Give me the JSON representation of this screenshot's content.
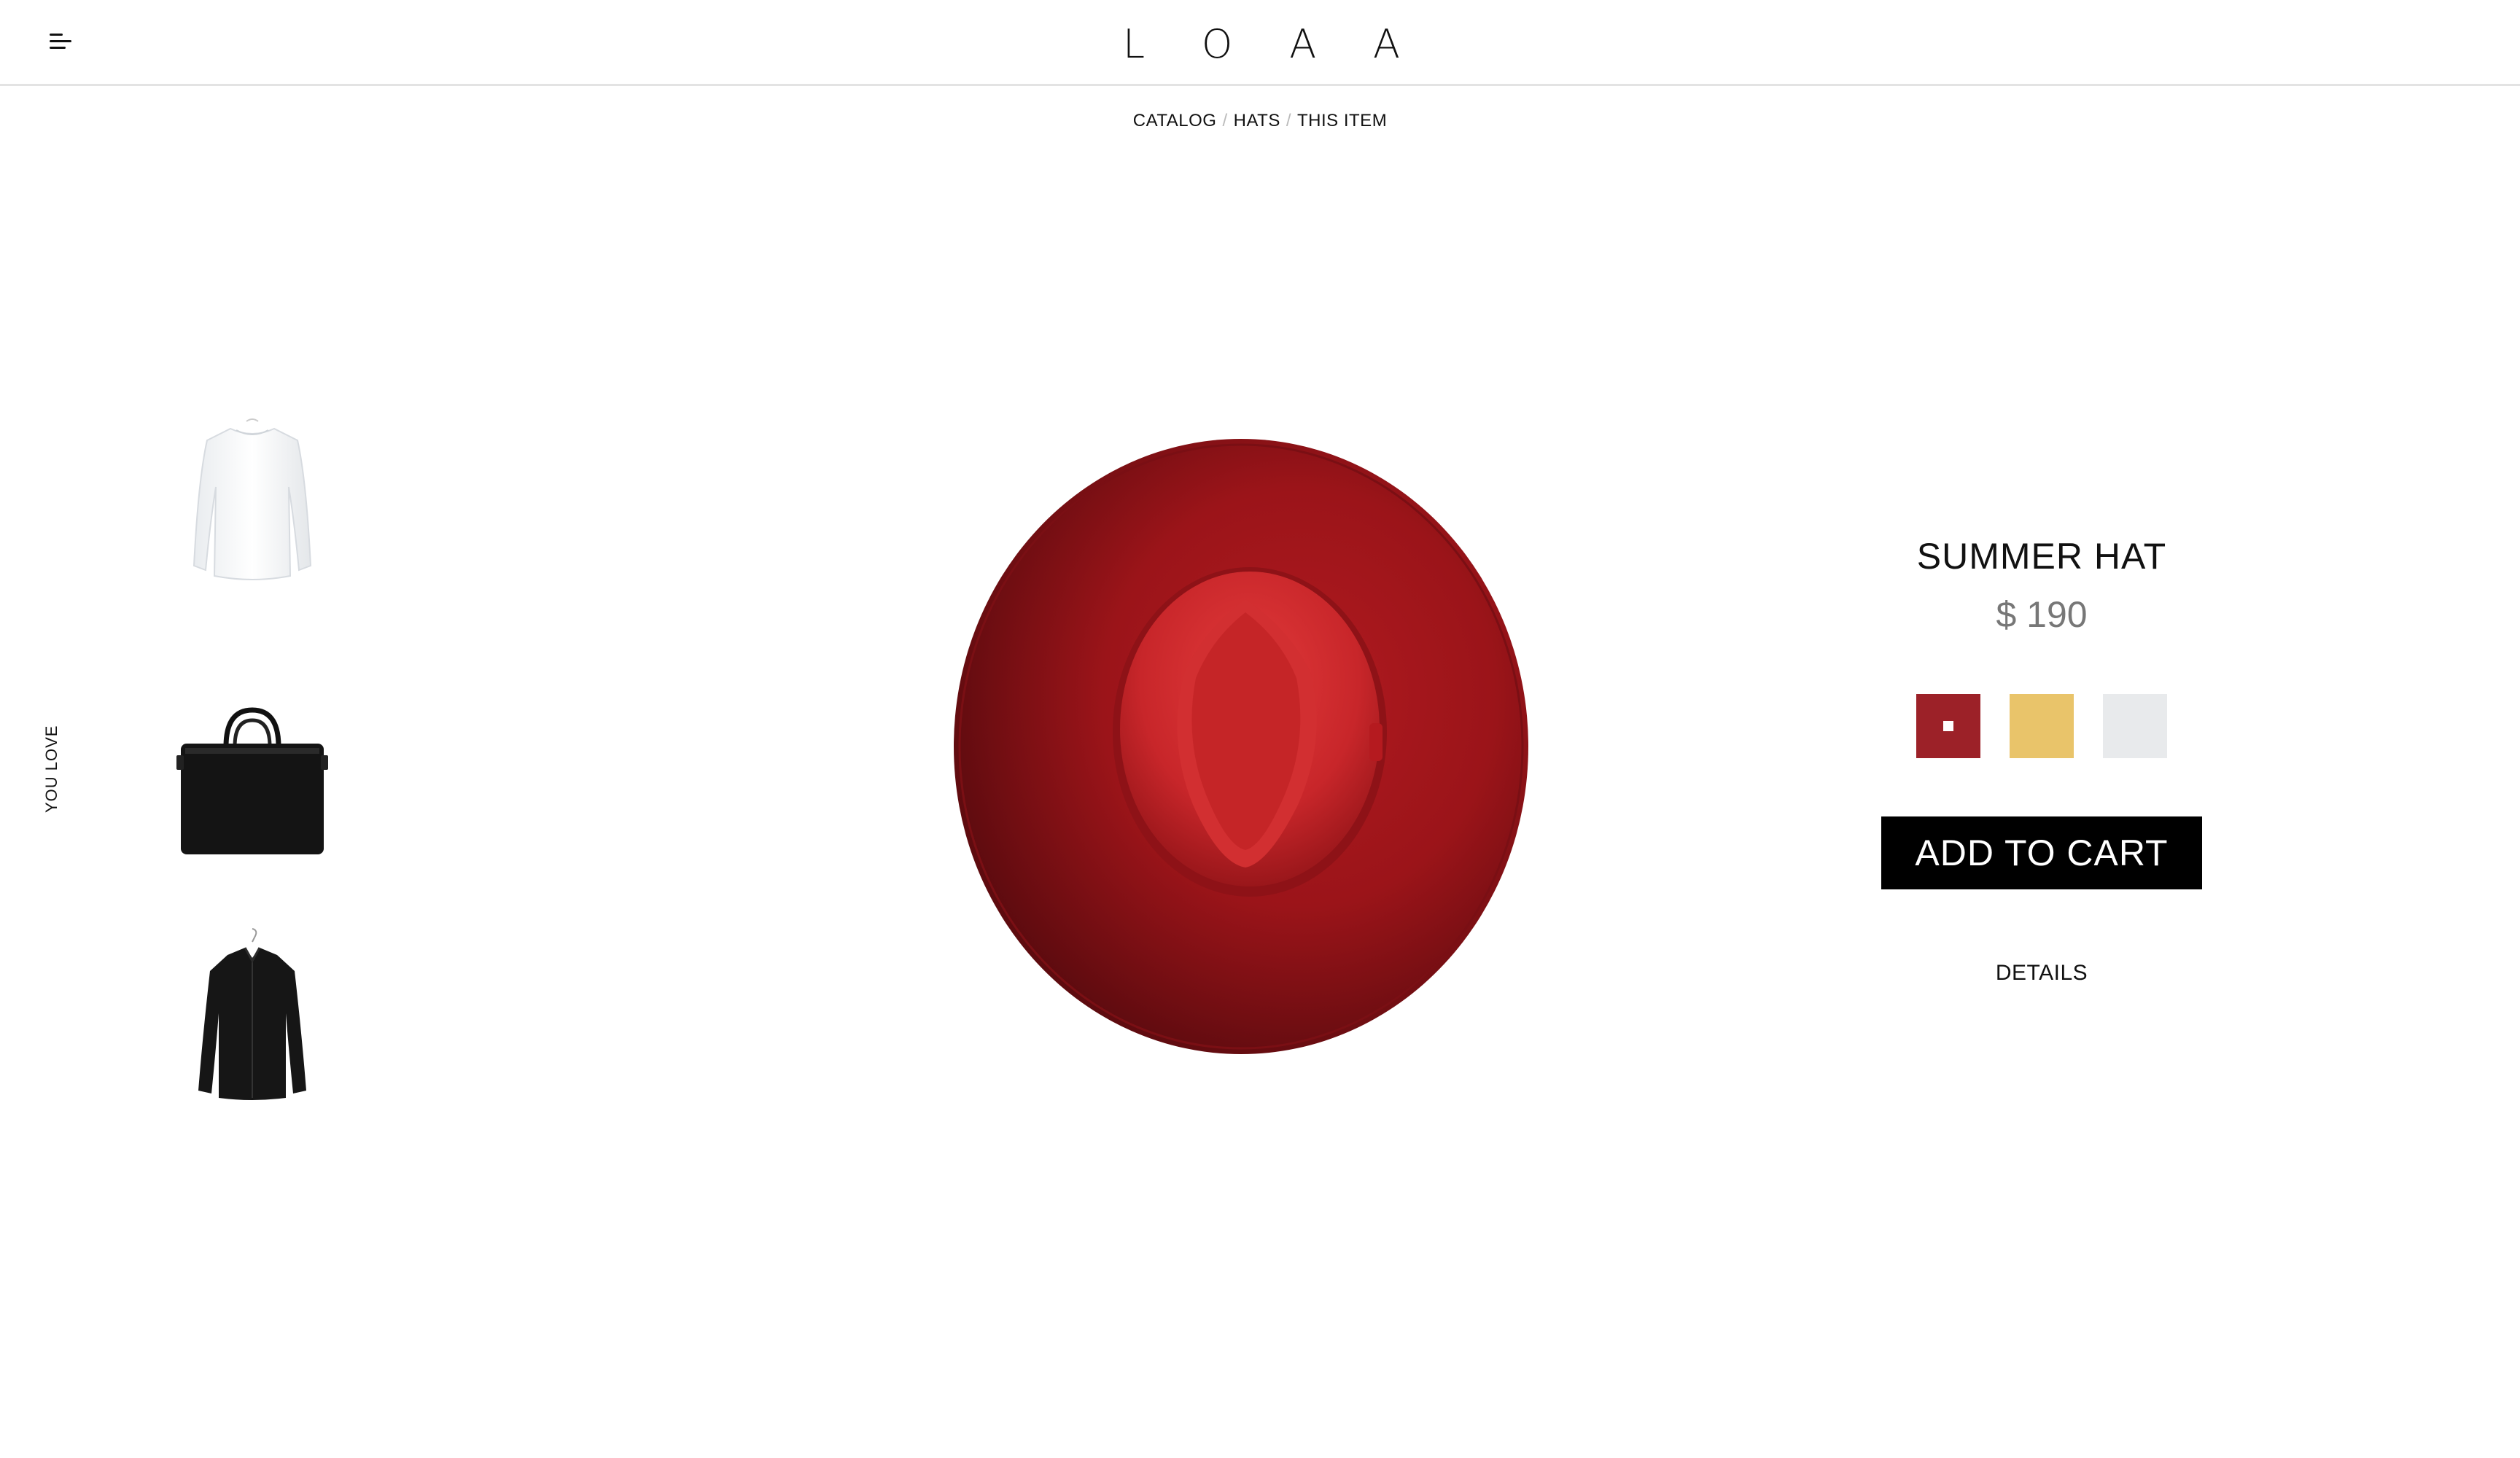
{
  "header": {
    "logo_letters": [
      "L",
      "O",
      "A",
      "A"
    ],
    "menu_icon": "menu-icon"
  },
  "breadcrumb": {
    "items": [
      "CATALOG",
      "HATS",
      "THIS ITEM"
    ],
    "separator": "/"
  },
  "sidebar": {
    "label": "YOU LOVE",
    "thumbnails": [
      {
        "name": "white sweatshirt",
        "icon": "white-sweatshirt-image"
      },
      {
        "name": "black leather bag",
        "icon": "black-bag-image"
      },
      {
        "name": "black shirt",
        "icon": "black-shirt-image"
      }
    ]
  },
  "product": {
    "image": "red-hat-image",
    "title": "SUMMER HAT",
    "price": "$ 190",
    "swatches": [
      {
        "color": "#9c2128",
        "selected": true
      },
      {
        "color": "#e9c46a",
        "selected": false
      },
      {
        "color": "#e8eaec",
        "selected": false
      }
    ],
    "add_to_cart_label": "ADD TO CART",
    "details_label": "DETAILS"
  },
  "colors": {
    "accent": "#000000",
    "hat_red": "#a3161c",
    "price_gray": "#777777"
  }
}
